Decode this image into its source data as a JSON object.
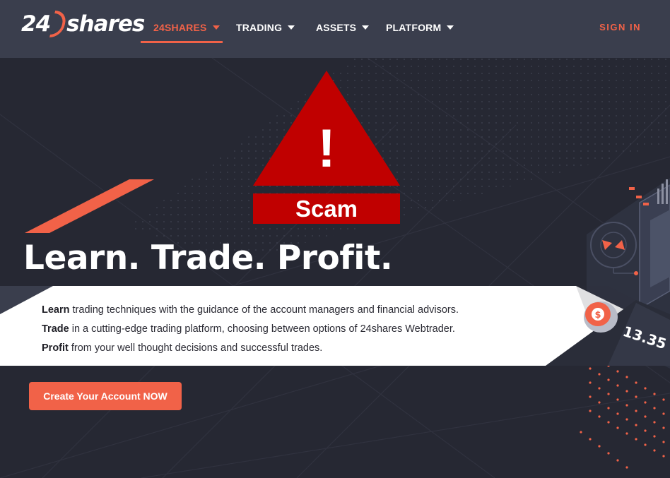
{
  "brand": {
    "logo_left": "24",
    "logo_right": "shares"
  },
  "nav": {
    "items": [
      {
        "label": "24SHARES"
      },
      {
        "label": "TRADING"
      },
      {
        "label": "ASSETS"
      },
      {
        "label": "PLATFORM"
      }
    ],
    "sign_in": "SIGN IN"
  },
  "overlay": {
    "mark": "!",
    "label": "Scam"
  },
  "hero": {
    "title": "Learn. Trade. Profit.",
    "lines": [
      {
        "bold": "Learn",
        "text": " trading techniques with the guidance of the account managers and financial advisors."
      },
      {
        "bold": "Trade",
        "text": " in a cutting-edge trading platform, choosing between options of 24shares Webtrader."
      },
      {
        "bold": "Profit",
        "text": " from your well thought decisions and successful trades."
      }
    ],
    "cta": "Create Your Account NOW"
  },
  "illustration": {
    "coin_symbol": "$",
    "number": "13.35"
  },
  "colors": {
    "accent": "#f16248",
    "nav_bg": "#3a3e4d",
    "page_bg": "#262833",
    "warning": "#c00000"
  }
}
